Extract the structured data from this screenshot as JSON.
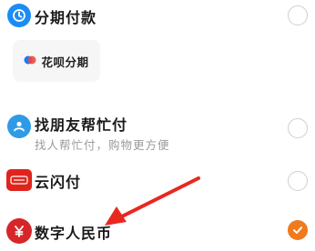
{
  "payment_options": [
    {
      "id": "fenqi",
      "title": "分期付款",
      "icon": "installment-icon",
      "selected": false
    },
    {
      "id": "friend",
      "title": "找朋友帮忙付",
      "subtitle": "找人帮忙付，购物更方便",
      "icon": "friend-pay-icon",
      "selected": false
    },
    {
      "id": "unionpay",
      "title": "云闪付",
      "icon": "unionpay-icon",
      "selected": false
    },
    {
      "id": "ecny",
      "title": "数字人民币",
      "icon": "ecny-icon",
      "selected": true
    }
  ],
  "huabei": {
    "label": "花呗分期",
    "icon": "huabei-icon"
  },
  "colors": {
    "accent": "#f07a1e",
    "annotation_arrow": "#e8281f"
  }
}
